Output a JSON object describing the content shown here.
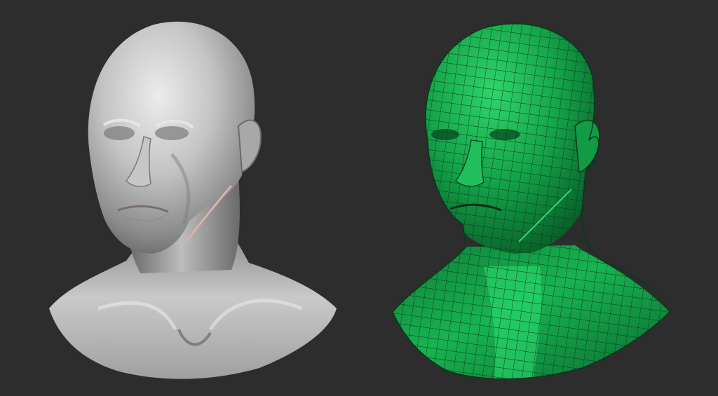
{
  "scene": {
    "background_color": "#2d2d2d",
    "models": [
      {
        "name": "sculpted-head",
        "material": "clay",
        "base_color": "#b9b9b9",
        "shadow_color": "#5a5a5a",
        "highlight_color": "#f2f2f2"
      },
      {
        "name": "retopology-head",
        "material": "wireframe-mesh",
        "base_color": "#16a24a",
        "shadow_color": "#06421d",
        "highlight_color": "#3ff27f",
        "wire_color": "#0b3d1c"
      }
    ]
  }
}
